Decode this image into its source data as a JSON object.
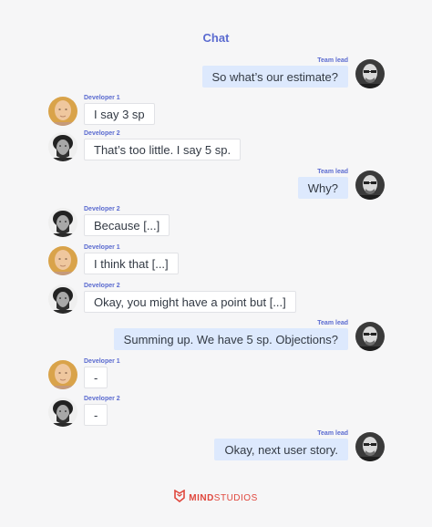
{
  "header": {
    "title": "Chat"
  },
  "messages": [
    {
      "author": "Team lead",
      "text": "So what’s our estimate?",
      "side": "right",
      "avatar": "team-lead"
    },
    {
      "author": "Developer 1",
      "text": "I say 3 sp",
      "side": "left",
      "avatar": "developer-1"
    },
    {
      "author": "Developer 2",
      "text": "That’s too little. I say 5 sp.",
      "side": "left",
      "avatar": "developer-2"
    },
    {
      "author": "Team lead",
      "text": "Why?",
      "side": "right",
      "avatar": "team-lead"
    },
    {
      "author": "Developer 2",
      "text": "Because [...]",
      "side": "left",
      "avatar": "developer-2"
    },
    {
      "author": "Developer 1",
      "text": "I think that [...]",
      "side": "left",
      "avatar": "developer-1"
    },
    {
      "author": "Developer 2",
      "text": "Okay, you might have a point but [...]",
      "side": "left",
      "avatar": "developer-2"
    },
    {
      "author": "Team lead",
      "text": "Summing up. We have 5 sp. Objections?",
      "side": "right",
      "avatar": "team-lead"
    },
    {
      "author": "Developer 1",
      "text": "-",
      "side": "left",
      "avatar": "developer-1"
    },
    {
      "author": "Developer 2",
      "text": "-",
      "side": "left",
      "avatar": "developer-2"
    },
    {
      "author": "Team lead",
      "text": "Okay, next user story.",
      "side": "right",
      "avatar": "team-lead"
    }
  ],
  "footer": {
    "brand_bold": "MIND",
    "brand_rest": "STUDIOS",
    "logo_icon": "mindstudios-logo-icon"
  },
  "colors": {
    "accent": "#5b6bd0",
    "own_bubble": "#dde9fd",
    "other_bubble": "#ffffff",
    "brand": "#e0473d",
    "background": "#f6f6f7"
  }
}
